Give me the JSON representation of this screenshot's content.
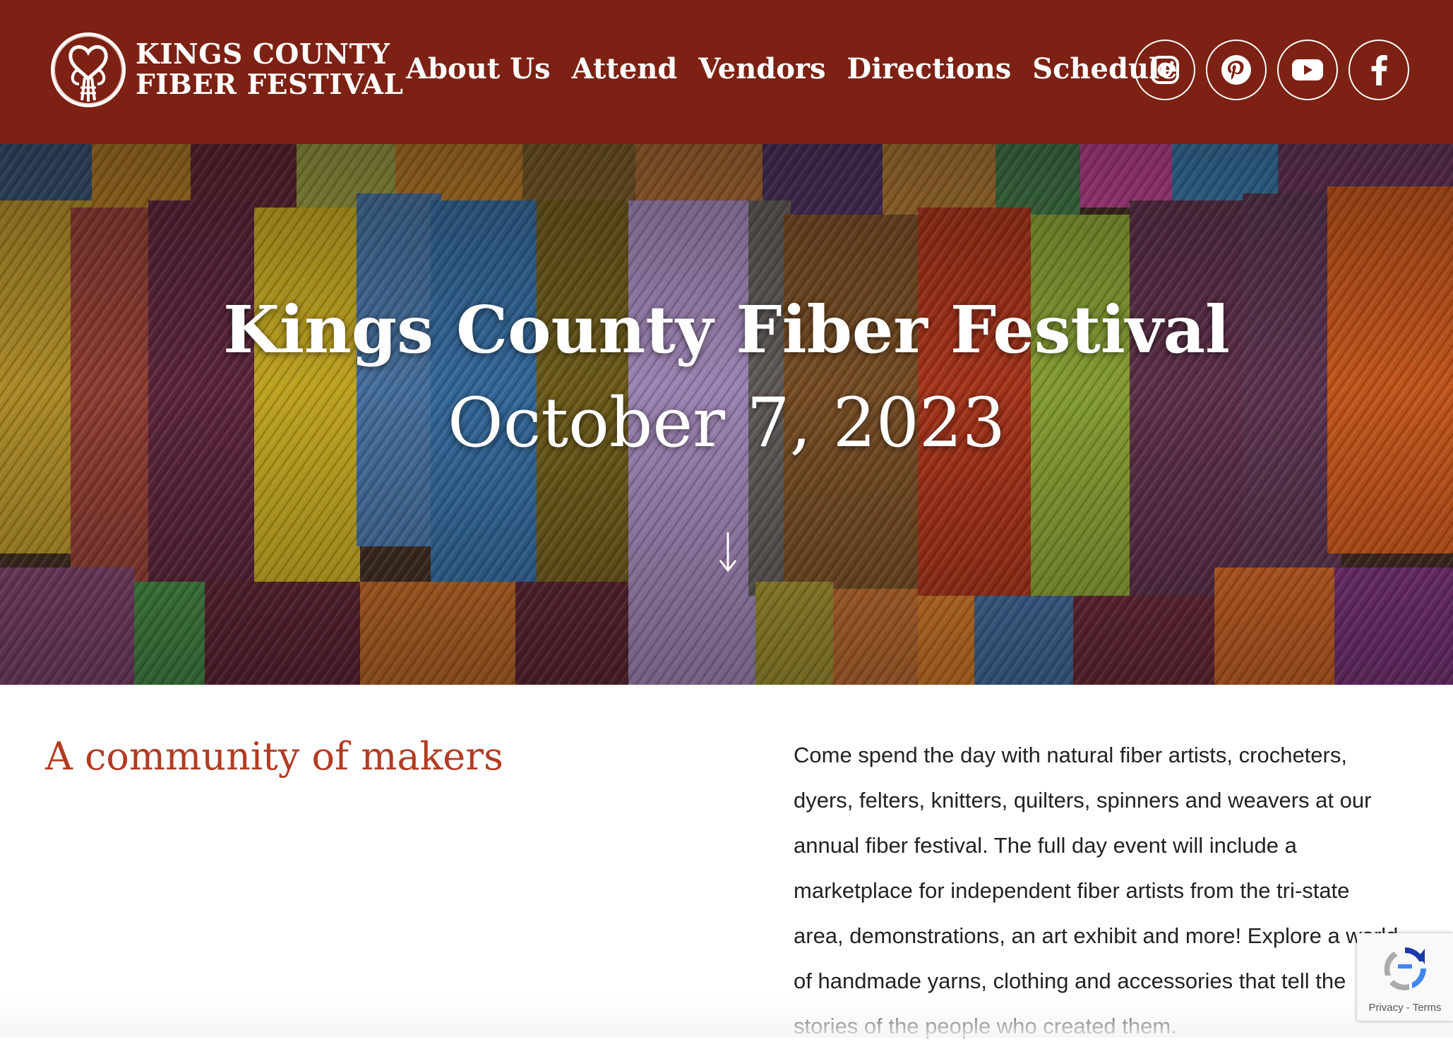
{
  "brand": {
    "line1": "KINGS COUNTY",
    "line2": "FIBER FESTIVAL"
  },
  "nav": {
    "items": [
      "About Us",
      "Attend",
      "Vendors",
      "Directions",
      "Schedule"
    ]
  },
  "social": {
    "icons": [
      "instagram-icon",
      "pinterest-icon",
      "youtube-icon",
      "facebook-icon"
    ]
  },
  "hero": {
    "title": "Kings County Fiber Festival",
    "date": "October 7, 2023"
  },
  "intro": {
    "heading": "A community of makers",
    "body": "Come spend the day with natural fiber artists, crocheters, dyers, felters, knitters, quilters, spinners and weavers at our annual fiber festival. The full day event will include a marketplace for independent fiber artists from the tri-state area, demonstrations, an art exhibit and more! Explore a world of handmade yarns, clothing and accessories that tell the stories of the people who created them."
  },
  "recaptcha": {
    "privacy": "Privacy",
    "separator": " - ",
    "terms": "Terms"
  },
  "colors": {
    "header_bg": "#7c2113",
    "heading_accent": "#b23b22",
    "text": "#222222"
  }
}
